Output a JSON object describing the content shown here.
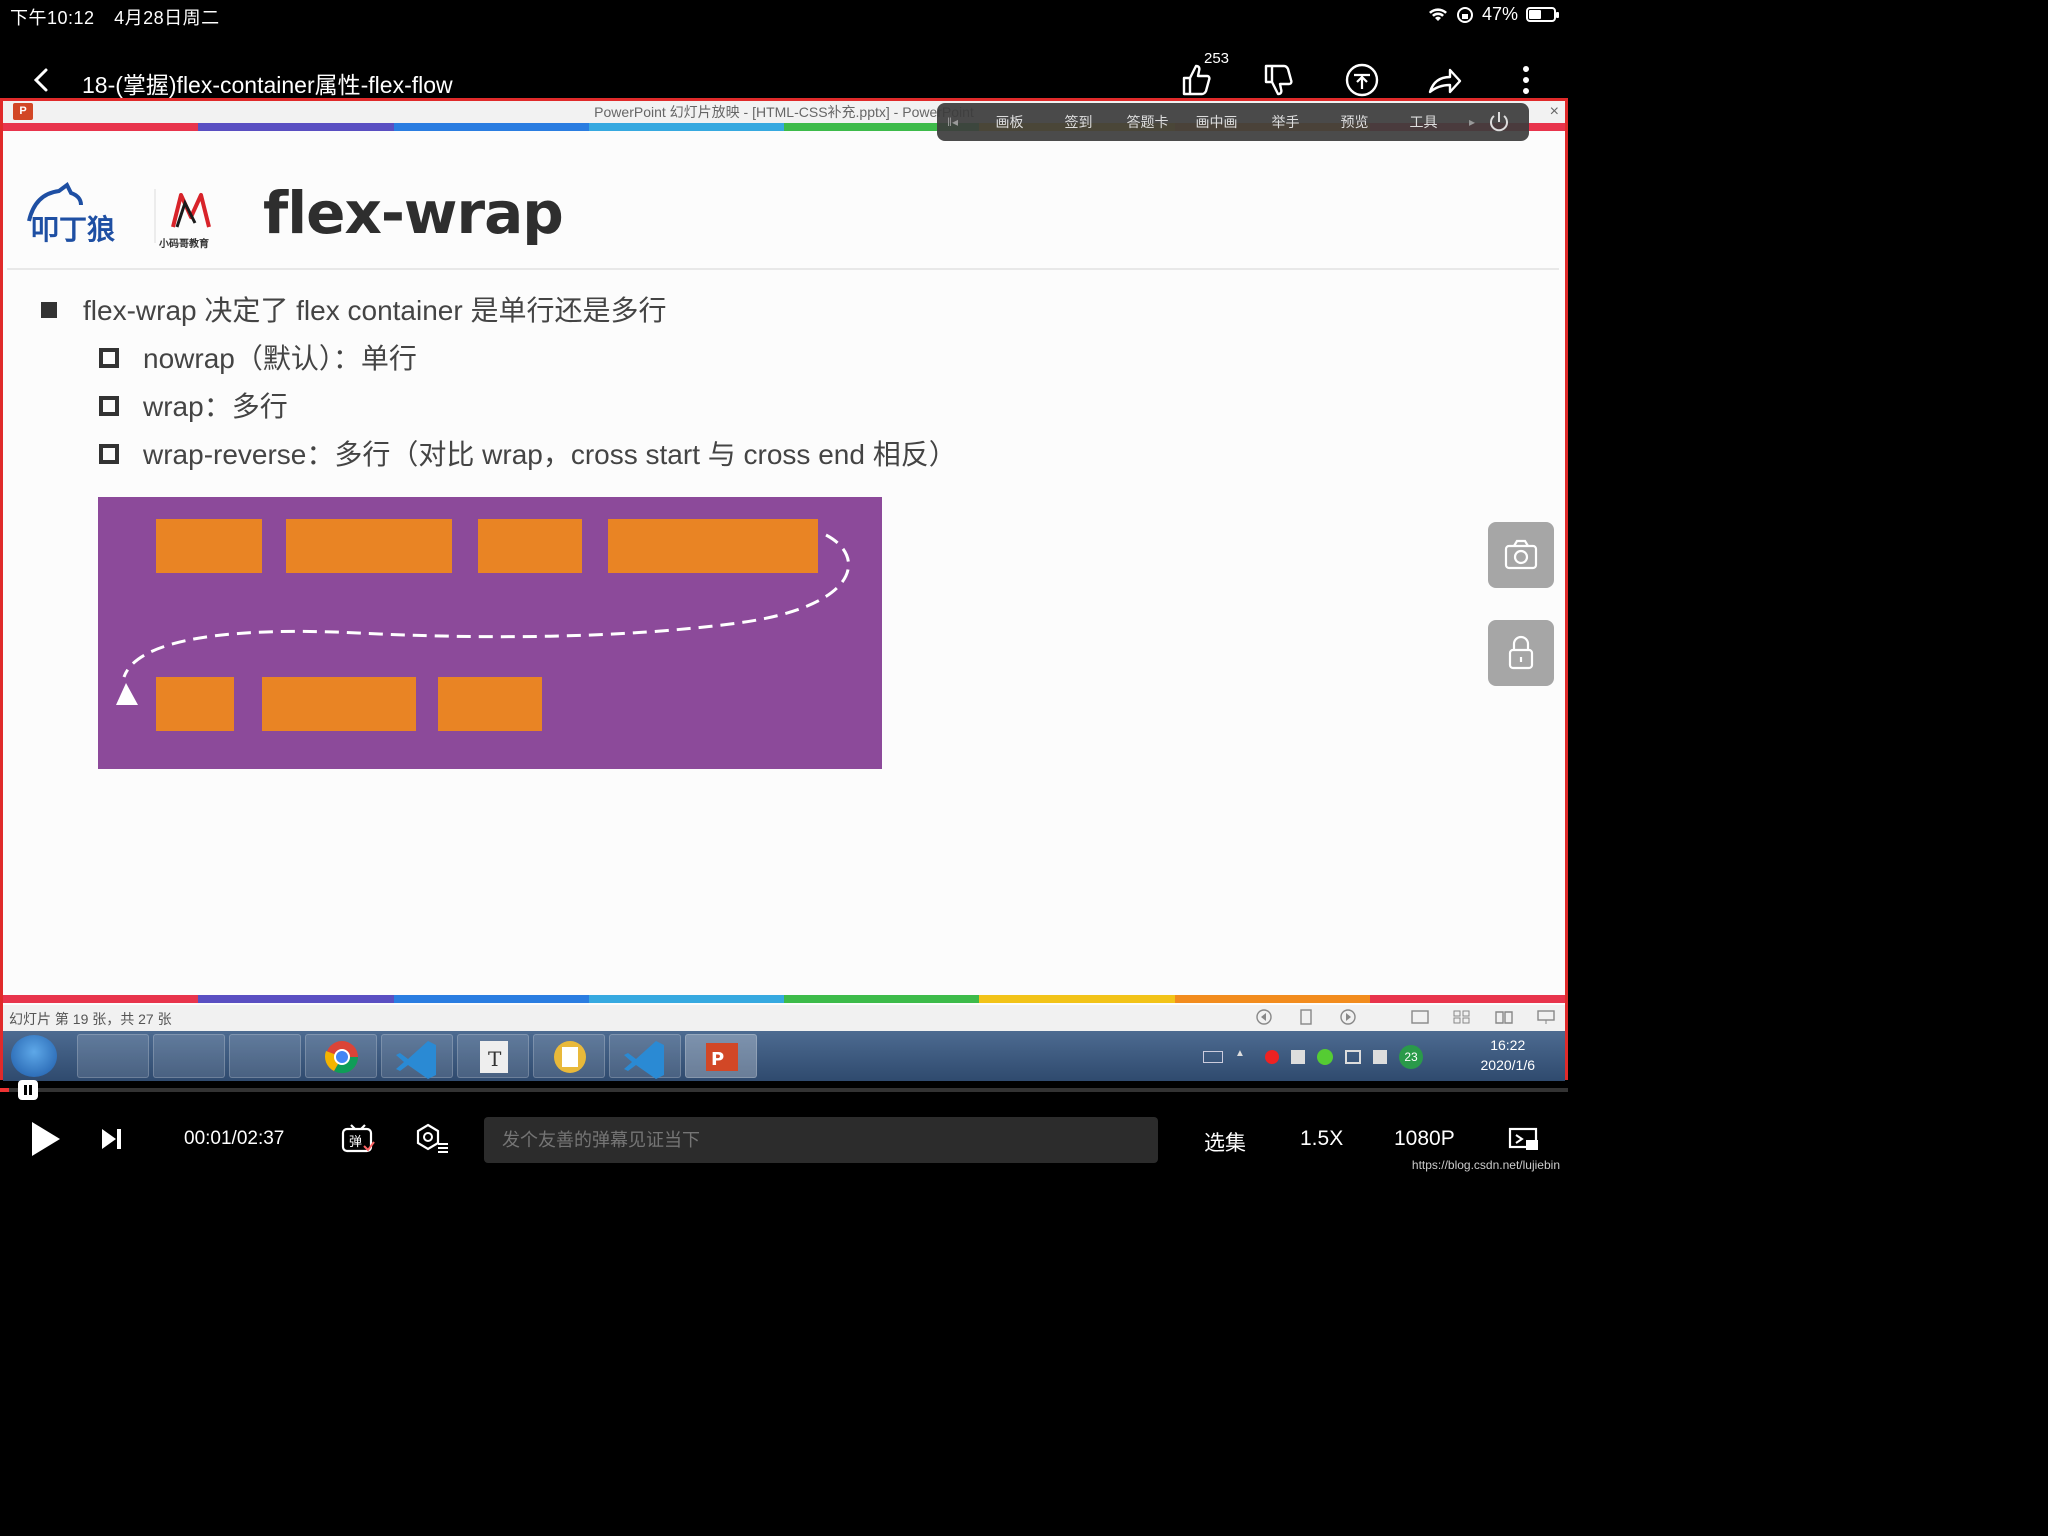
{
  "status_bar": {
    "time": "下午10:12",
    "date": "4月28日周二",
    "battery": "47%",
    "battery_level": 0.47
  },
  "top_bar": {
    "title": "18-(掌握)flex-container属性-flex-flow",
    "like_count": "253"
  },
  "ppt": {
    "window_title": "PowerPoint 幻灯片放映 - [HTML-CSS补充.pptx] - PowerPoint",
    "close": "×",
    "toolbar": [
      "画板",
      "签到",
      "答题卡",
      "画中画",
      "举手",
      "预览",
      "工具"
    ],
    "rainbow_colors": [
      "#e8344c",
      "#5a4fc2",
      "#2a7de1",
      "#36a9e0",
      "#3dbb4a",
      "#f2c318",
      "#f28c1e",
      "#e8344c"
    ]
  },
  "slide": {
    "title": "flex-wrap",
    "logo_text_left": "叩丁狼",
    "logo_text_right": "小码哥教育",
    "bullet_main": "flex-wrap 决定了 flex container 是单行还是多行",
    "sub_bullets": [
      "nowrap（默认）：单行",
      "wrap：多行",
      "wrap-reverse：多行（对比 wrap，cross start 与 cross end 相反）"
    ],
    "demo_colors": {
      "container": "#8c4a9a",
      "item": "#e98424"
    }
  },
  "ppt_status": {
    "slide_counter": "幻灯片 第 19 张，共 27 张"
  },
  "taskbar": {
    "tray_badge": "23",
    "clock_time": "16:22",
    "clock_date": "2020/1/6"
  },
  "player": {
    "current_time": "00:01/02:37",
    "progress": 0.006,
    "danmaku_placeholder": "发个友善的弹幕见证当下",
    "episodes": "选集",
    "speed": "1.5X",
    "quality": "1080P",
    "watermark": "https://blog.csdn.net/lujiebin"
  }
}
